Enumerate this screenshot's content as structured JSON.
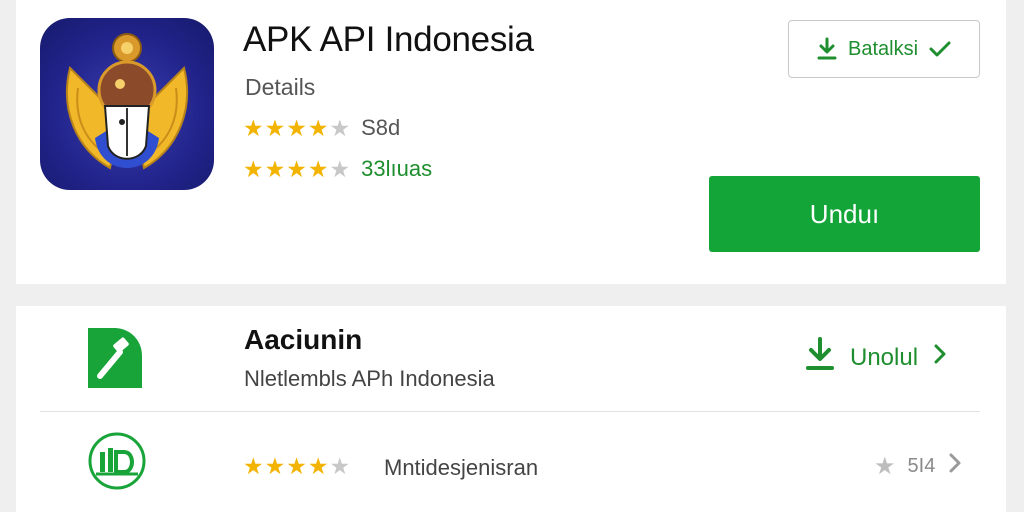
{
  "app": {
    "title": "APK API Indonesia",
    "details_label": "Details",
    "rating_value_label": "S8d",
    "rating_count_label": "33lıuas",
    "rating_1_stars": 4,
    "rating_2_stars": 4,
    "icon": "garuda-emblem-icon"
  },
  "top_install": {
    "label": "Batalksi",
    "left_icon": "download-icon",
    "right_icon": "check-icon"
  },
  "unduh_button": {
    "label": "Unduı"
  },
  "list": {
    "row1": {
      "title": "Aaciunin",
      "subtitle": "Nletlembls APh Indonesia",
      "action_label": "Unolul",
      "icon": "hammer-icon"
    },
    "row2": {
      "label": "Mntidesjenisran",
      "stars": 4,
      "meta": "5I4",
      "icon": "idn-emblem-icon"
    }
  },
  "colors": {
    "accent_green": "#13a538",
    "text_green": "#1e8e2e",
    "star_gold": "#f2b400",
    "icon_bg": "#21238a"
  }
}
